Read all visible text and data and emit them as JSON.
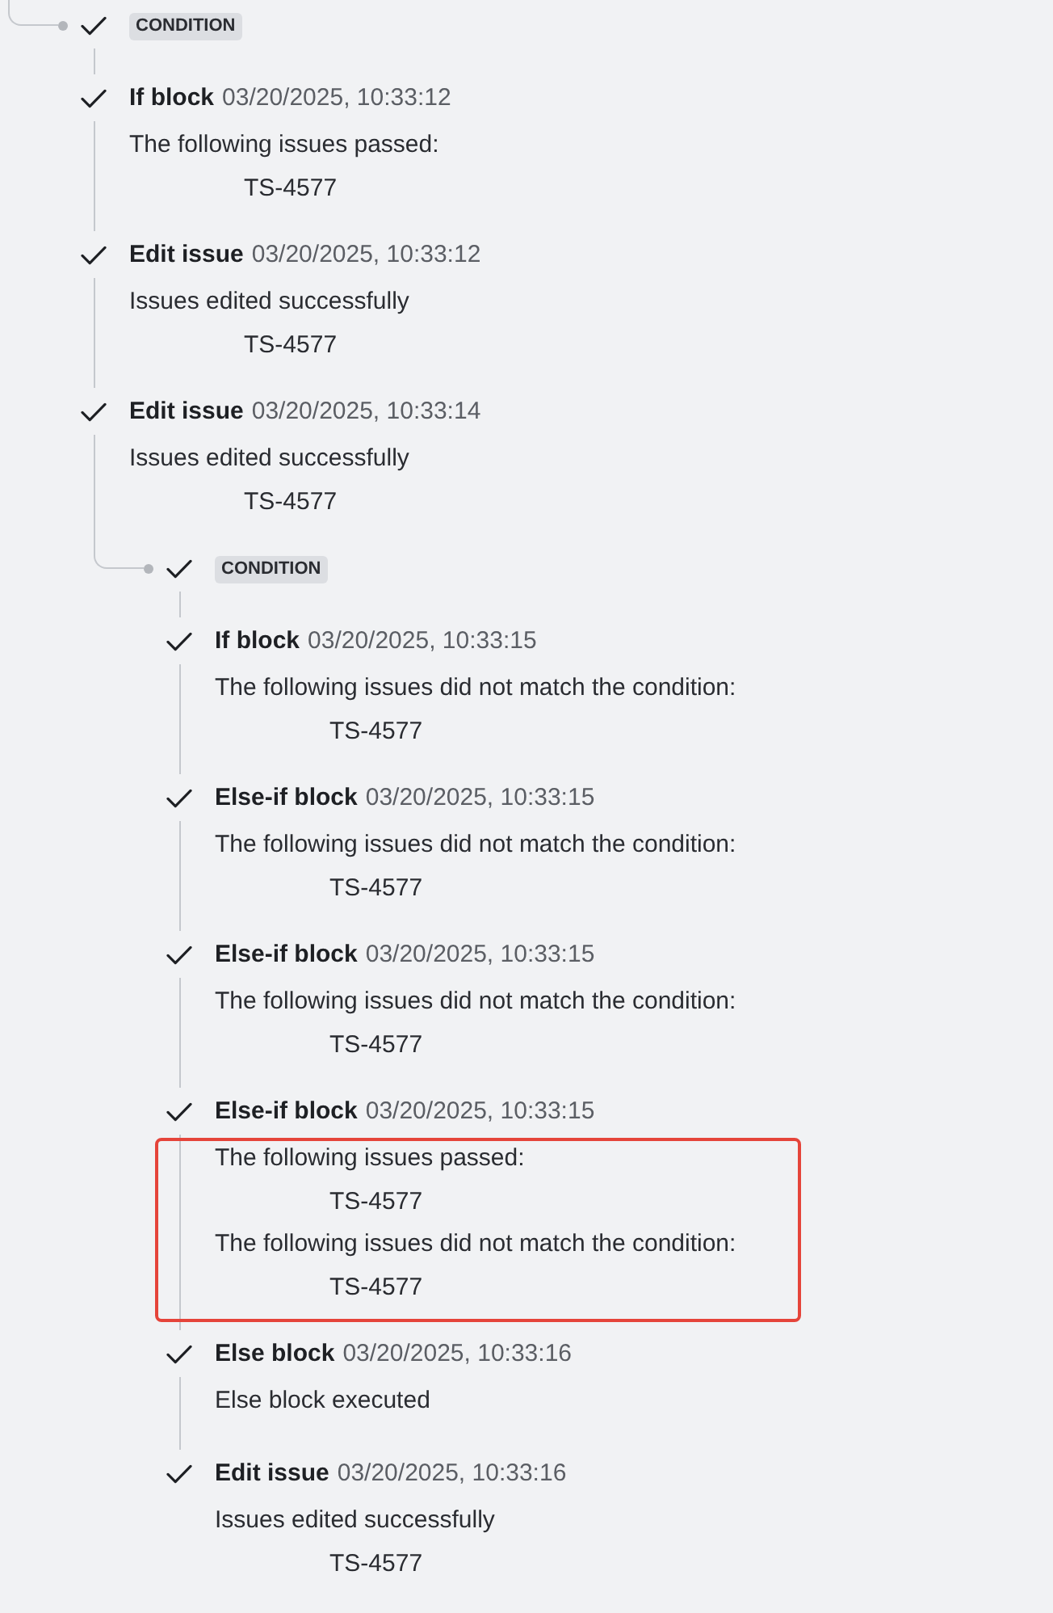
{
  "tree": {
    "kind": "condition",
    "succeeded": true,
    "badge": "CONDITION",
    "children": [
      {
        "kind": "step",
        "succeeded": true,
        "title": "If block",
        "time": "03/20/2025, 10:33:12",
        "highlighted": false,
        "messages": [
          {
            "text": "The following issues passed:",
            "issues": [
              "TS-4577"
            ]
          }
        ]
      },
      {
        "kind": "step",
        "succeeded": true,
        "title": "Edit issue",
        "time": "03/20/2025, 10:33:12",
        "highlighted": false,
        "messages": [
          {
            "text": "Issues edited successfully",
            "issues": [
              "TS-4577"
            ]
          }
        ]
      },
      {
        "kind": "step",
        "succeeded": true,
        "title": "Edit issue",
        "time": "03/20/2025, 10:33:14",
        "highlighted": false,
        "messages": [
          {
            "text": "Issues edited successfully",
            "issues": [
              "TS-4577"
            ]
          }
        ]
      },
      {
        "kind": "condition",
        "succeeded": true,
        "badge": "CONDITION",
        "children": [
          {
            "kind": "step",
            "succeeded": true,
            "title": "If block",
            "time": "03/20/2025, 10:33:15",
            "highlighted": false,
            "messages": [
              {
                "text": "The following issues did not match the condition:",
                "issues": [
                  "TS-4577"
                ]
              }
            ]
          },
          {
            "kind": "step",
            "succeeded": true,
            "title": "Else-if block",
            "time": "03/20/2025, 10:33:15",
            "highlighted": false,
            "messages": [
              {
                "text": "The following issues did not match the condition:",
                "issues": [
                  "TS-4577"
                ]
              }
            ]
          },
          {
            "kind": "step",
            "succeeded": true,
            "title": "Else-if block",
            "time": "03/20/2025, 10:33:15",
            "highlighted": false,
            "messages": [
              {
                "text": "The following issues did not match the condition:",
                "issues": [
                  "TS-4577"
                ]
              }
            ]
          },
          {
            "kind": "step",
            "succeeded": true,
            "title": "Else-if block",
            "time": "03/20/2025, 10:33:15",
            "highlighted": true,
            "messages": [
              {
                "text": "The following issues passed:",
                "issues": [
                  "TS-4577"
                ]
              },
              {
                "text": "The following issues did not match the condition:",
                "issues": [
                  "TS-4577"
                ]
              }
            ]
          },
          {
            "kind": "step",
            "succeeded": true,
            "title": "Else block",
            "time": "03/20/2025, 10:33:16",
            "highlighted": false,
            "messages": [
              {
                "text": "Else block executed"
              }
            ]
          },
          {
            "kind": "step",
            "succeeded": true,
            "title": "Edit issue",
            "time": "03/20/2025, 10:33:16",
            "highlighted": false,
            "messages": [
              {
                "text": "Issues edited successfully",
                "issues": [
                  "TS-4577"
                ]
              }
            ]
          }
        ]
      }
    ]
  }
}
